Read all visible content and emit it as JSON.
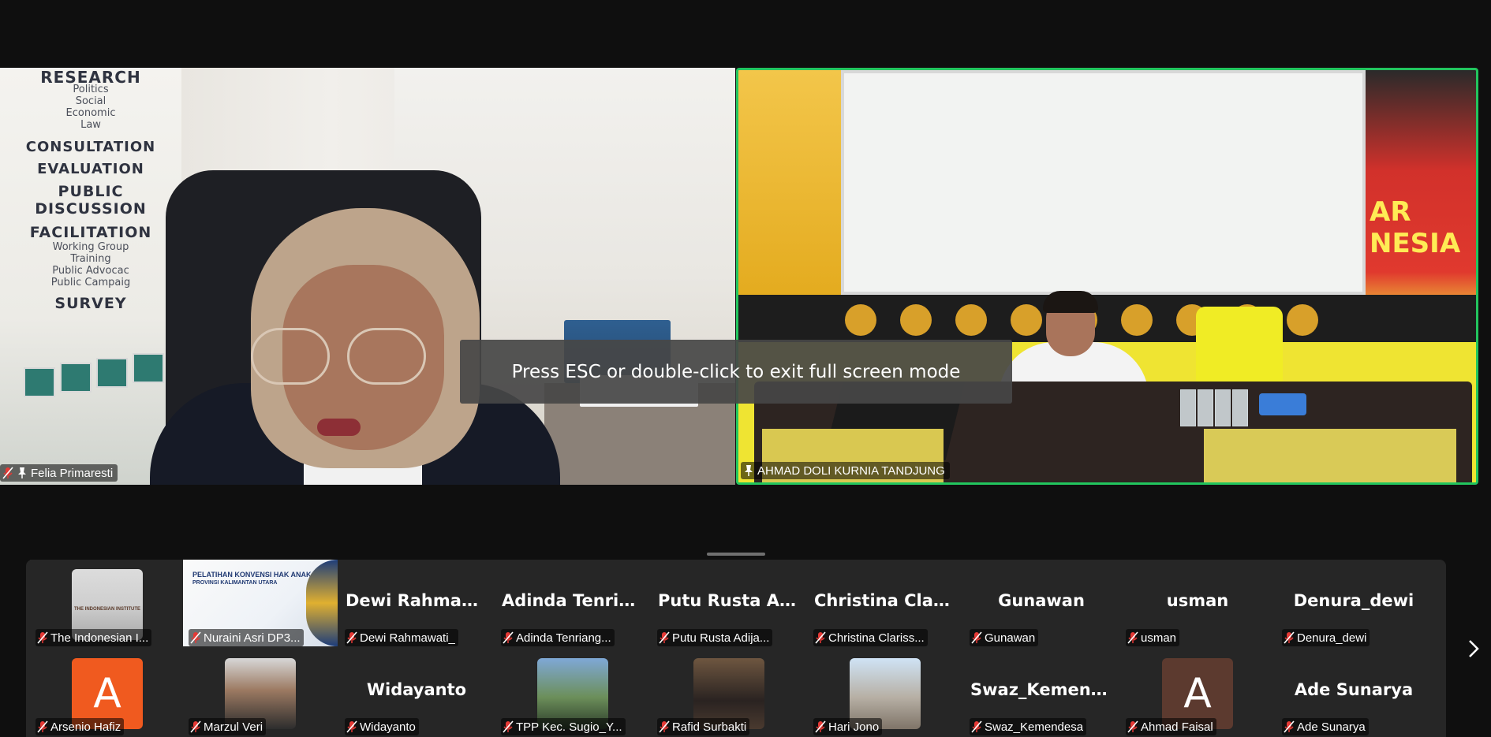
{
  "toast": {
    "message": "Press ESC or double-click to exit full screen mode"
  },
  "main_tiles": [
    {
      "name": "Felia Primaresti",
      "muted": true,
      "pinned": true,
      "active_speaker": false,
      "banner": {
        "research": "RESEARCH",
        "research_items": [
          "Politics",
          "Social",
          "Economic",
          "Law"
        ],
        "consultation": "CONSULTATION",
        "evaluation": "EVALUATION",
        "public_discussion_1": "PUBLIC",
        "public_discussion_2": "DISCUSSION",
        "facilitation": "FACILITATION",
        "facilitation_items": [
          "Working Group",
          "Training",
          "Public Advocac",
          "Public Campaig"
        ],
        "survey": "SURVEY"
      }
    },
    {
      "name": "AHMAD DOLI KURNIA TANDJUNG",
      "muted": false,
      "pinned": true,
      "active_speaker": true,
      "poster_text": "AR\nNESIA"
    }
  ],
  "gallery": {
    "row1": [
      {
        "label": "The Indonesian I...",
        "type": "image",
        "muted": true
      },
      {
        "label": "Nuraini Asri DP3...",
        "type": "image",
        "muted": true
      },
      {
        "label": "Dewi Rahmawati_",
        "bigname": "Dewi Rahmawati_",
        "type": "name",
        "muted": true
      },
      {
        "label": "Adinda Tenriang...",
        "bigname": "Adinda Tenrian...",
        "type": "name",
        "muted": true
      },
      {
        "label": "Putu Rusta Adija...",
        "bigname": "Putu Rusta Adij...",
        "type": "name",
        "muted": true
      },
      {
        "label": "Christina Clariss...",
        "bigname": "Christina Clariss...",
        "type": "name",
        "muted": true
      },
      {
        "label": "Gunawan",
        "bigname": "Gunawan",
        "type": "name",
        "muted": true
      },
      {
        "label": "usman",
        "bigname": "usman",
        "type": "name",
        "muted": true
      },
      {
        "label": "Denura_dewi",
        "bigname": "Denura_dewi",
        "type": "name",
        "muted": true
      }
    ],
    "row2": [
      {
        "label": "Arsenio Hafiz",
        "type": "letter",
        "letter": "A",
        "color": "#f05a1f",
        "muted": true
      },
      {
        "label": "Marzul Veri",
        "type": "image",
        "muted": true
      },
      {
        "label": "Widayanto",
        "bigname": "Widayanto",
        "type": "name",
        "muted": true
      },
      {
        "label": "TPP Kec. Sugio_Y...",
        "type": "image",
        "muted": true
      },
      {
        "label": "Rafid Surbakti",
        "type": "image",
        "muted": true
      },
      {
        "label": "Hari Jono",
        "type": "image",
        "muted": true
      },
      {
        "label": "Swaz_Kemendesa",
        "bigname": "Swaz_Kemendesa",
        "type": "name",
        "muted": true
      },
      {
        "label": "Ahmad Faisal",
        "type": "letter",
        "letter": "A",
        "color": "#5c3a2f",
        "muted": true
      },
      {
        "label": "Ade Sunarya",
        "bigname": "Ade Sunarya",
        "type": "name",
        "muted": true
      }
    ],
    "thumb_institute_text": "THE INDONESIAN INSTITUTE",
    "thumb_pelatihan_title": "PELATIHAN KONVENSI HAK ANAK (KHA",
    "thumb_pelatihan_subtitle": "PROVINSI KALIMANTAN UTARA"
  },
  "colors": {
    "background": "#0f0f0f",
    "gallery_bg": "#262626",
    "active_speaker_border": "#22c55e",
    "muted_icon": "#e53935",
    "toast_bg": "#464646"
  },
  "icons": {
    "mute": "mic-off-icon",
    "pin": "pin-icon",
    "next": "chevron-right-icon"
  }
}
